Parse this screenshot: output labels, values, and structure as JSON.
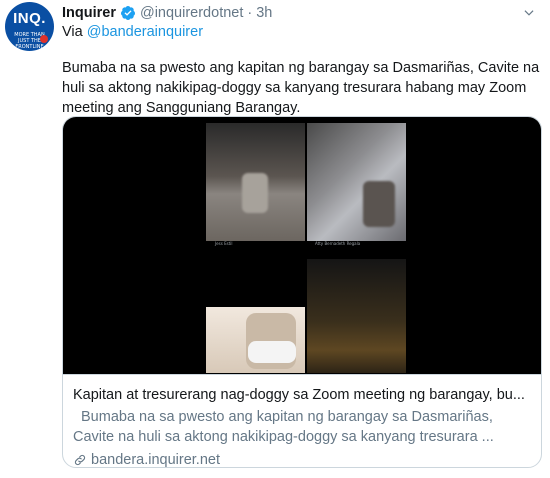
{
  "account": {
    "avatar_text": "INQ.",
    "avatar_subtext": "MORE THAN JUST THE FRONTLINE",
    "name": "Inquirer",
    "handle": "@inquirerdotnet",
    "separator": "·",
    "time": "3h"
  },
  "via": {
    "prefix": "Via",
    "mention": "@banderainquirer"
  },
  "tweet_text": "Bumaba na sa pwesto ang kapitan ng barangay sa Dasmariñas, Cavite na huli sa aktong nakikipag-doggy sa kanyang tresurara habang may Zoom meeting ang Sangguniang Barangay.",
  "card": {
    "image_captions": [
      "Jess Estil",
      "Atty Bernadeth Regala"
    ],
    "title": "Kapitan at tresurerang nag-doggy sa Zoom meeting ng barangay, bu...",
    "description_line1": "Bumaba na sa pwesto ang kapitan ng barangay sa Dasmariñas,",
    "description_line2": "Cavite na huli sa aktong nakikipag-doggy sa kanyang tresurara ...",
    "domain": "bandera.inquirer.net"
  },
  "icons": {
    "verified": "verified-badge-icon",
    "caret": "chevron-down-icon",
    "link": "link-icon"
  },
  "colors": {
    "link": "#1b95e0",
    "secondary_text": "#657786",
    "border": "#ccd6dd",
    "avatar_bg": "#0a4fa3"
  }
}
